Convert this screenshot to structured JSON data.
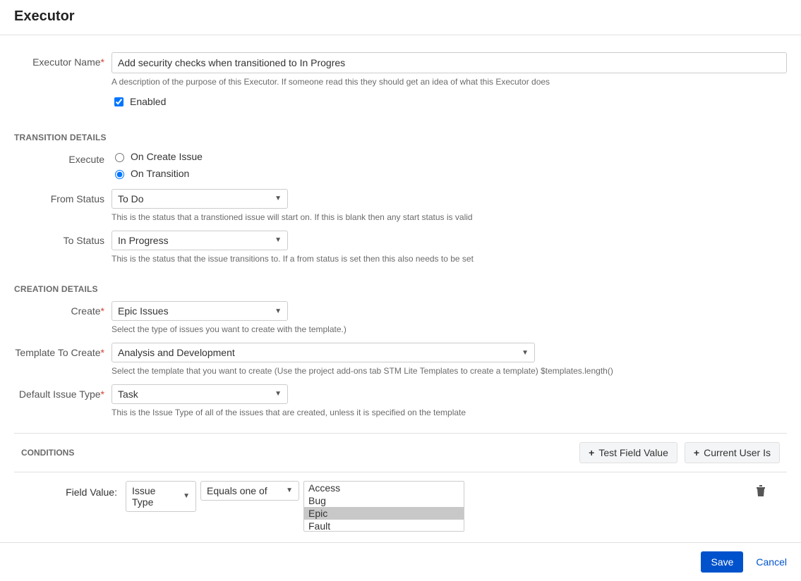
{
  "header": {
    "title": "Executor"
  },
  "form": {
    "executor_name": {
      "label": "Executor Name",
      "value": "Add security checks when transitioned to In Progres",
      "hint": "A description of the purpose of this Executor. If someone read this they should get an idea of what this Executor does"
    },
    "enabled": {
      "label": "Enabled",
      "checked": true
    }
  },
  "transition": {
    "heading": "TRANSITION DETAILS",
    "execute_label": "Execute",
    "options": {
      "on_create": "On Create Issue",
      "on_transition": "On Transition"
    },
    "selected": "on_transition",
    "from_status": {
      "label": "From Status",
      "value": "To Do",
      "hint": "This is the status that a transtioned issue will start on. If this is blank then any start status is valid"
    },
    "to_status": {
      "label": "To Status",
      "value": "In Progress",
      "hint": "This is the status that the issue transitions to. If a from status is set then this also needs to be set"
    }
  },
  "creation": {
    "heading": "CREATION DETAILS",
    "create": {
      "label": "Create",
      "value": "Epic Issues",
      "hint": "Select the type of issues you want to create with the template.)"
    },
    "template": {
      "label": "Template To Create",
      "value": "Analysis and Development",
      "hint": "Select the template that you want to create (Use the project add-ons tab STM Lite Templates to create a template) $templates.length()"
    },
    "issue_type": {
      "label": "Default Issue Type",
      "value": "Task",
      "hint": "This is the Issue Type of all of the issues that are created, unless it is specified on the template"
    }
  },
  "conditions": {
    "heading": "CONDITIONS",
    "btn_test": "Test Field Value",
    "btn_user": "Current User Is",
    "field_value_label": "Field Value:",
    "field_select": "Issue Type",
    "operator_select": "Equals one of",
    "options": [
      {
        "label": "Access",
        "selected": false
      },
      {
        "label": "Bug",
        "selected": false
      },
      {
        "label": "Epic",
        "selected": true
      },
      {
        "label": "Fault",
        "selected": false
      }
    ]
  },
  "footer": {
    "save": "Save",
    "cancel": "Cancel"
  }
}
